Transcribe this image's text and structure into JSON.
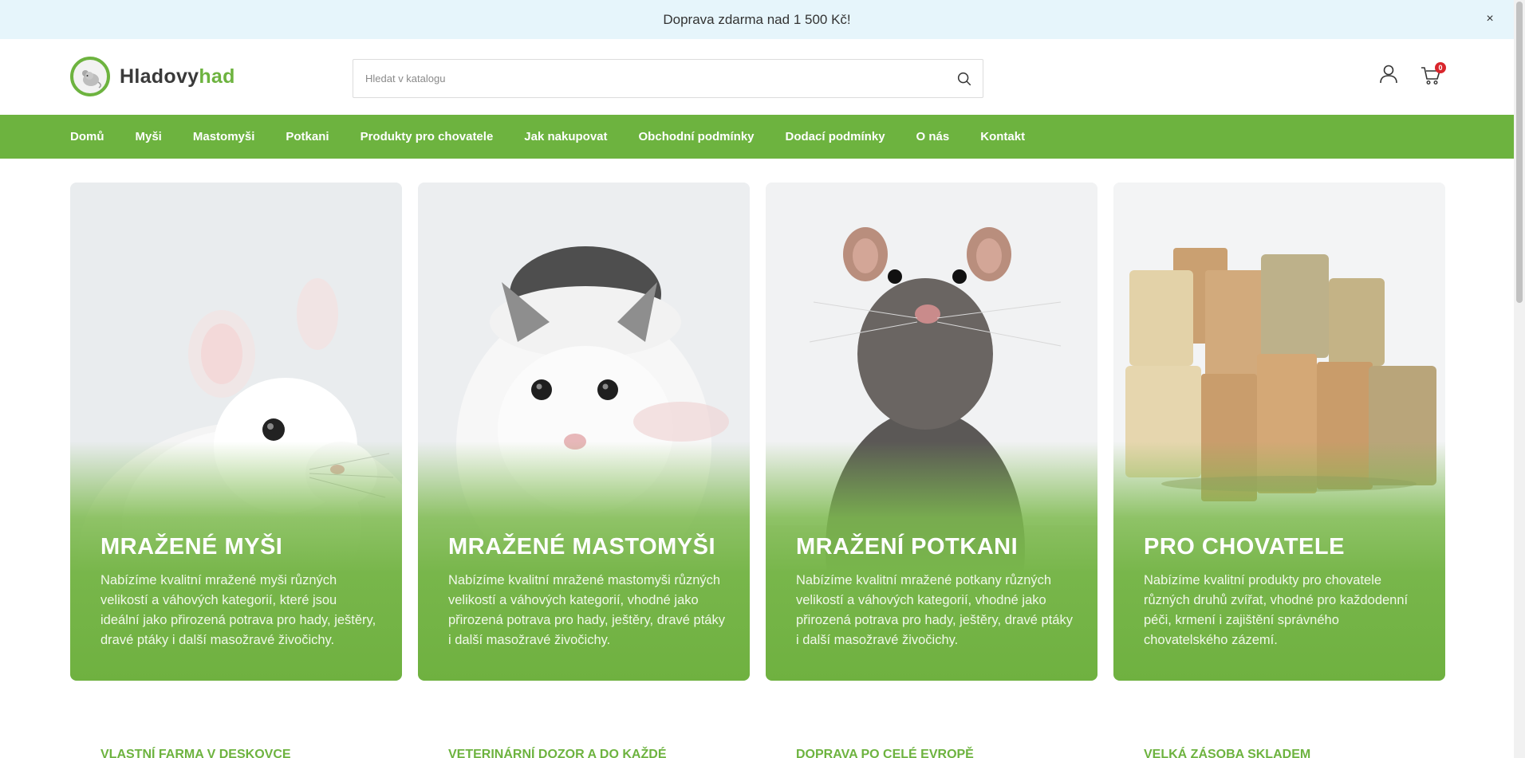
{
  "announcement": {
    "text": "Doprava zdarma nad 1 500 Kč!",
    "close": "×"
  },
  "header": {
    "logo": {
      "text_main": "Hladovy",
      "text_accent": "had"
    },
    "search": {
      "placeholder": "Hledat v katalogu",
      "value": ""
    },
    "cart": {
      "count": "0"
    }
  },
  "nav": {
    "items": [
      {
        "label": "Domů"
      },
      {
        "label": "Myši"
      },
      {
        "label": "Mastomyši"
      },
      {
        "label": "Potkani"
      },
      {
        "label": "Produkty pro chovatele"
      },
      {
        "label": "Jak nakupovat"
      },
      {
        "label": "Obchodní podmínky"
      },
      {
        "label": "Dodací podmínky"
      },
      {
        "label": "O nás"
      },
      {
        "label": "Kontakt"
      }
    ]
  },
  "cards": [
    {
      "title": "MRAŽENÉ MYŠI",
      "text": "Nabízíme kvalitní mražené myši různých velikostí a váhových kategorií, které jsou ideální jako přirozená potrava pro hady, ještěry, dravé ptáky i další masožravé živočichy."
    },
    {
      "title": "MRAŽENÉ MASTOMYŠI",
      "text": "Nabízíme kvalitní mražené mastomyši různých velikostí a váhových kategorií, vhodné jako přirozená potrava pro hady, ještěry, dravé ptáky i další masožravé živočichy."
    },
    {
      "title": "MRAŽENÍ POTKANI",
      "text": "Nabízíme kvalitní mražené potkany různých velikostí a váhových kategorií, vhodné jako přirozená potrava pro hady, ještěry, dravé ptáky i další masožravé živočichy."
    },
    {
      "title": "PRO CHOVATELE",
      "text": "Nabízíme kvalitní produkty pro chovatele různých druhů zvířat, vhodné pro každodenní péči, krmení i zajištění správného chovatelského zázemí."
    }
  ],
  "features": [
    {
      "label": "VLASTNÍ FARMA V DESKOVCE"
    },
    {
      "label": "VETERINÁRNÍ DOZOR A DO KAŽDÉ"
    },
    {
      "label": "DOPRAVA PO CELÉ EVROPĚ"
    },
    {
      "label": "VELKÁ ZÁSOBA SKLADEM"
    }
  ],
  "colors": {
    "brand_green": "#6db33f",
    "announce_bg": "#e6f5fb",
    "badge_red": "#d9262c"
  }
}
